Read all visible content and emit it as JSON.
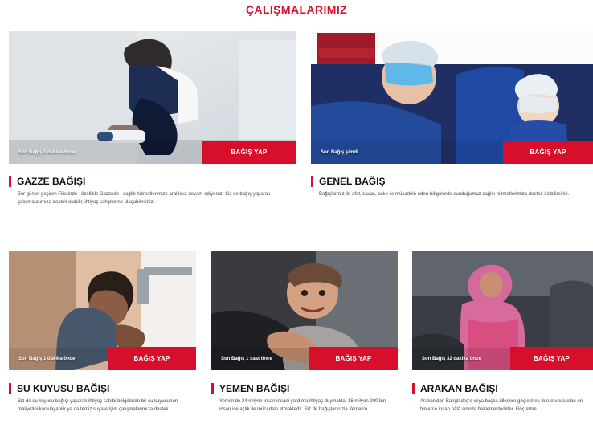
{
  "section": {
    "title": "ÇALIŞMALARIMIZ"
  },
  "colors": {
    "brand_red": "#d80f2a"
  },
  "cards": [
    {
      "title": "GAZZE BAĞIŞI",
      "button": "BAĞIŞ YAP",
      "stamp": "Son Bağış 1 dakika önce",
      "description": "Zor günler geçiren Filistinde –özellikle Gazzede– sağlık hizmetlerimize aralıksız devam ediyoruz. Siz de bağış yaparak çalışmalarımıza destek olabilir, ihtiyaç sahiplerine ulaşabilirsiniz."
    },
    {
      "title": "GENEL BAĞIŞ",
      "button": "BAĞIŞ YAP",
      "stamp": "Son Bağış şimdi",
      "description": "Bağışlarınız ile afet, savaş, açlık ile mücadele eden bölgelerde sunduğumuz sağlık hizmetlerimize destek olabilirsiniz."
    },
    {
      "title": "SU KUYUSU BAĞIŞI",
      "button": "BAĞIŞ YAP",
      "stamp": "Son Bağış 1 dakika önce",
      "description": "Siz de su kuyusu bağışı yaparak ihtiyaç sahibi bölgelerde bir su kuyusunun maliyetini karşılayabilir ya da temiz suya erişim çalışmalarımıza destek..."
    },
    {
      "title": "YEMEN BAĞIŞI",
      "button": "BAĞIŞ YAP",
      "stamp": "Son Bağış 1 saat önce",
      "description": "Yemen'de 24 milyon insan insani yardıma ihtiyaç duymakta, 16 milyon 200 bin insan ise açlık ile mücadele etmektedir. Siz de bağışlarınızla Yemen'e..."
    },
    {
      "title": "ARAKAN BAĞIŞI",
      "button": "BAĞIŞ YAP",
      "stamp": "Son Bağış 32 dakika önce",
      "description": "Arakan'dan Bangladeş'e veya başka ülkelere göç etmek durumunda olan on binlerce insan hâlâ sınırda beklemektedirler. Göç etme..."
    }
  ]
}
